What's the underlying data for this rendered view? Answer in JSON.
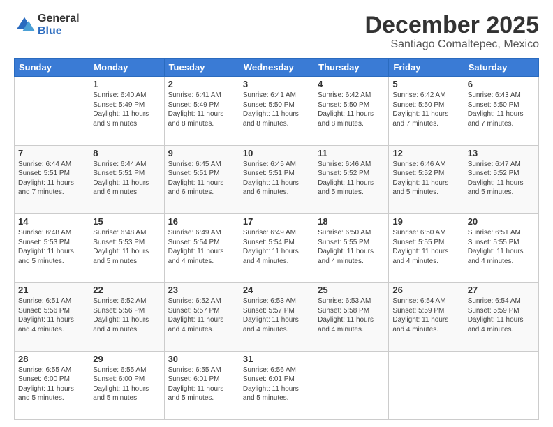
{
  "header": {
    "logo_general": "General",
    "logo_blue": "Blue",
    "main_title": "December 2025",
    "subtitle": "Santiago Comaltepec, Mexico"
  },
  "days_of_week": [
    "Sunday",
    "Monday",
    "Tuesday",
    "Wednesday",
    "Thursday",
    "Friday",
    "Saturday"
  ],
  "weeks": [
    [
      {
        "day": "",
        "sunrise": "",
        "sunset": "",
        "daylight": ""
      },
      {
        "day": "1",
        "sunrise": "6:40 AM",
        "sunset": "5:49 PM",
        "daylight": "11 hours and 9 minutes."
      },
      {
        "day": "2",
        "sunrise": "6:41 AM",
        "sunset": "5:49 PM",
        "daylight": "11 hours and 8 minutes."
      },
      {
        "day": "3",
        "sunrise": "6:41 AM",
        "sunset": "5:50 PM",
        "daylight": "11 hours and 8 minutes."
      },
      {
        "day": "4",
        "sunrise": "6:42 AM",
        "sunset": "5:50 PM",
        "daylight": "11 hours and 8 minutes."
      },
      {
        "day": "5",
        "sunrise": "6:42 AM",
        "sunset": "5:50 PM",
        "daylight": "11 hours and 7 minutes."
      },
      {
        "day": "6",
        "sunrise": "6:43 AM",
        "sunset": "5:50 PM",
        "daylight": "11 hours and 7 minutes."
      }
    ],
    [
      {
        "day": "7",
        "sunrise": "6:44 AM",
        "sunset": "5:51 PM",
        "daylight": "11 hours and 7 minutes."
      },
      {
        "day": "8",
        "sunrise": "6:44 AM",
        "sunset": "5:51 PM",
        "daylight": "11 hours and 6 minutes."
      },
      {
        "day": "9",
        "sunrise": "6:45 AM",
        "sunset": "5:51 PM",
        "daylight": "11 hours and 6 minutes."
      },
      {
        "day": "10",
        "sunrise": "6:45 AM",
        "sunset": "5:51 PM",
        "daylight": "11 hours and 6 minutes."
      },
      {
        "day": "11",
        "sunrise": "6:46 AM",
        "sunset": "5:52 PM",
        "daylight": "11 hours and 5 minutes."
      },
      {
        "day": "12",
        "sunrise": "6:46 AM",
        "sunset": "5:52 PM",
        "daylight": "11 hours and 5 minutes."
      },
      {
        "day": "13",
        "sunrise": "6:47 AM",
        "sunset": "5:52 PM",
        "daylight": "11 hours and 5 minutes."
      }
    ],
    [
      {
        "day": "14",
        "sunrise": "6:48 AM",
        "sunset": "5:53 PM",
        "daylight": "11 hours and 5 minutes."
      },
      {
        "day": "15",
        "sunrise": "6:48 AM",
        "sunset": "5:53 PM",
        "daylight": "11 hours and 5 minutes."
      },
      {
        "day": "16",
        "sunrise": "6:49 AM",
        "sunset": "5:54 PM",
        "daylight": "11 hours and 4 minutes."
      },
      {
        "day": "17",
        "sunrise": "6:49 AM",
        "sunset": "5:54 PM",
        "daylight": "11 hours and 4 minutes."
      },
      {
        "day": "18",
        "sunrise": "6:50 AM",
        "sunset": "5:55 PM",
        "daylight": "11 hours and 4 minutes."
      },
      {
        "day": "19",
        "sunrise": "6:50 AM",
        "sunset": "5:55 PM",
        "daylight": "11 hours and 4 minutes."
      },
      {
        "day": "20",
        "sunrise": "6:51 AM",
        "sunset": "5:55 PM",
        "daylight": "11 hours and 4 minutes."
      }
    ],
    [
      {
        "day": "21",
        "sunrise": "6:51 AM",
        "sunset": "5:56 PM",
        "daylight": "11 hours and 4 minutes."
      },
      {
        "day": "22",
        "sunrise": "6:52 AM",
        "sunset": "5:56 PM",
        "daylight": "11 hours and 4 minutes."
      },
      {
        "day": "23",
        "sunrise": "6:52 AM",
        "sunset": "5:57 PM",
        "daylight": "11 hours and 4 minutes."
      },
      {
        "day": "24",
        "sunrise": "6:53 AM",
        "sunset": "5:57 PM",
        "daylight": "11 hours and 4 minutes."
      },
      {
        "day": "25",
        "sunrise": "6:53 AM",
        "sunset": "5:58 PM",
        "daylight": "11 hours and 4 minutes."
      },
      {
        "day": "26",
        "sunrise": "6:54 AM",
        "sunset": "5:59 PM",
        "daylight": "11 hours and 4 minutes."
      },
      {
        "day": "27",
        "sunrise": "6:54 AM",
        "sunset": "5:59 PM",
        "daylight": "11 hours and 4 minutes."
      }
    ],
    [
      {
        "day": "28",
        "sunrise": "6:55 AM",
        "sunset": "6:00 PM",
        "daylight": "11 hours and 5 minutes."
      },
      {
        "day": "29",
        "sunrise": "6:55 AM",
        "sunset": "6:00 PM",
        "daylight": "11 hours and 5 minutes."
      },
      {
        "day": "30",
        "sunrise": "6:55 AM",
        "sunset": "6:01 PM",
        "daylight": "11 hours and 5 minutes."
      },
      {
        "day": "31",
        "sunrise": "6:56 AM",
        "sunset": "6:01 PM",
        "daylight": "11 hours and 5 minutes."
      },
      {
        "day": "",
        "sunrise": "",
        "sunset": "",
        "daylight": ""
      },
      {
        "day": "",
        "sunrise": "",
        "sunset": "",
        "daylight": ""
      },
      {
        "day": "",
        "sunrise": "",
        "sunset": "",
        "daylight": ""
      }
    ]
  ],
  "labels": {
    "sunrise": "Sunrise:",
    "sunset": "Sunset:",
    "daylight": "Daylight:"
  }
}
